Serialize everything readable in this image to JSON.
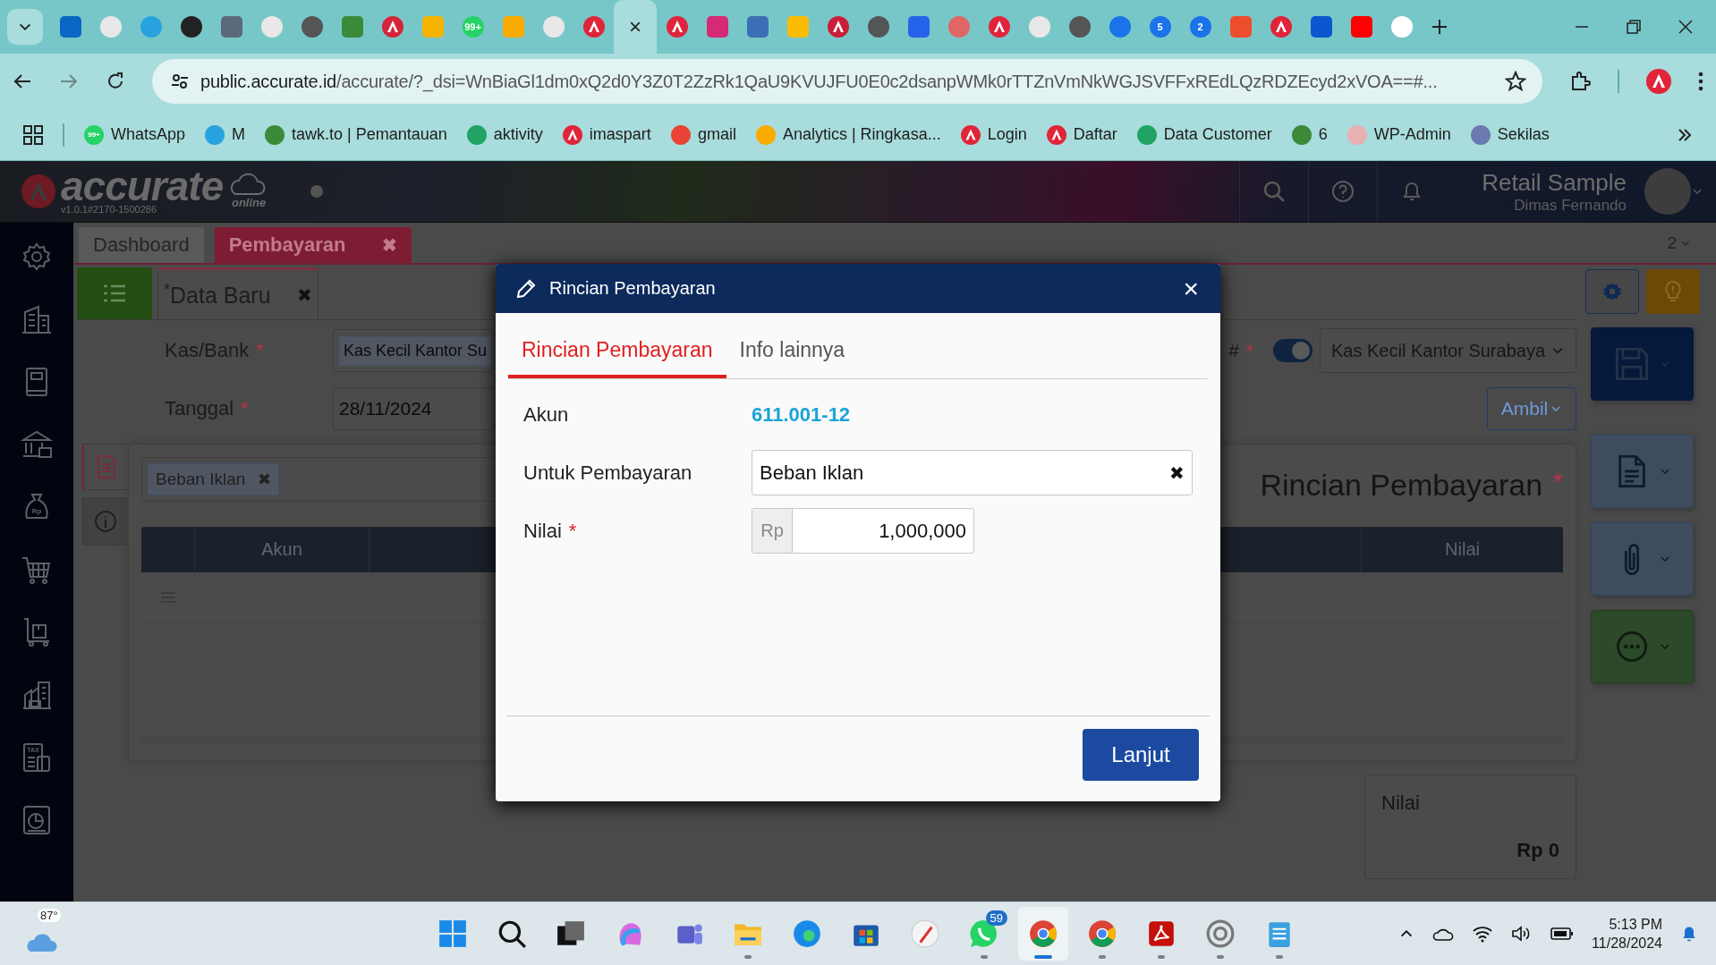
{
  "browser": {
    "tabs": [
      {
        "selected": false
      },
      {
        "selected": false
      },
      {
        "selected": false
      },
      {
        "selected": false
      },
      {
        "selected": false
      },
      {
        "selected": false
      },
      {
        "selected": false
      },
      {
        "selected": false
      },
      {
        "selected": false
      },
      {
        "selected": false
      },
      {
        "selected": false,
        "badge": "99+"
      },
      {
        "selected": false
      },
      {
        "selected": false
      },
      {
        "selected": false
      },
      {
        "selected": true,
        "close": "×"
      },
      {
        "selected": false
      },
      {
        "selected": false
      },
      {
        "selected": false
      },
      {
        "selected": false
      },
      {
        "selected": false
      },
      {
        "selected": false
      },
      {
        "selected": false
      },
      {
        "selected": false
      },
      {
        "selected": false
      },
      {
        "selected": false
      },
      {
        "selected": false
      },
      {
        "selected": false
      },
      {
        "selected": false,
        "badge": "5"
      },
      {
        "selected": false,
        "badge": "2"
      },
      {
        "selected": false
      },
      {
        "selected": false
      },
      {
        "selected": false
      },
      {
        "selected": false
      },
      {
        "selected": false
      }
    ],
    "address": {
      "host": "public.accurate.id",
      "path": "/accurate/?_dsi=WnBiaGl1dm0xQ2d0Y3Z0T2ZzRk1QaU9KVUJFU0E0c2dsanpWMk0rTTZnVmNkWGJSVFFxREdLQzRDZEcyd2xVOA==#..."
    },
    "bookmarks": [
      {
        "label": "WhatsApp",
        "badge": "99+"
      },
      {
        "label": "M"
      },
      {
        "label": "tawk.to | Pemantauan"
      },
      {
        "label": "aktivity"
      },
      {
        "label": "imaspart"
      },
      {
        "label": "gmail"
      },
      {
        "label": "Analytics | Ringkasa..."
      },
      {
        "label": "Login"
      },
      {
        "label": "Daftar"
      },
      {
        "label": "Data Customer"
      },
      {
        "label": "6"
      },
      {
        "label": "WP-Admin"
      },
      {
        "label": "Sekilas"
      }
    ]
  },
  "app": {
    "logo": "accurate",
    "logo_sub": "online",
    "version": "v1.0.1#2170-1500286",
    "company": "Retail Sample",
    "user": "Dimas Fernando"
  },
  "sidebar": {
    "bag_label": "Rp",
    "tax_label": "TAX"
  },
  "page_tabs": [
    {
      "label": "Dashboard",
      "selected": false
    },
    {
      "label": "Pembayaran",
      "selected": true,
      "close": "✖"
    }
  ],
  "tab_count": "2",
  "form": {
    "tab": {
      "label": "Data Baru",
      "modified_mark": "*",
      "close": "✖"
    },
    "fields": [
      {
        "label": "Kas/Bank",
        "mark": "*",
        "value": "Kas Kecil Kantor Su"
      },
      {
        "label": "Tanggal",
        "mark": "*",
        "value": "28/11/2024"
      }
    ],
    "number_label": "#",
    "number_mark": "*",
    "auto_number": {
      "on": true
    },
    "bank_select": "Kas Kecil Kantor Surabaya",
    "fetch_button": "Ambil"
  },
  "panel": {
    "tags": [
      {
        "label": "Beban Iklan",
        "close": "✖"
      }
    ],
    "title": "Rincian Pembayaran",
    "title_mark": "*",
    "columns": [
      "Akun",
      "Nilai"
    ]
  },
  "summary": {
    "label": "Nilai",
    "value": "Rp 0"
  },
  "modal": {
    "title": "Rincian Pembayaran",
    "close": "×",
    "tabs": [
      {
        "label": "Rincian Pembayaran",
        "selected": true
      },
      {
        "label": "Info lainnya",
        "selected": false
      }
    ],
    "rows": [
      {
        "kind": "link",
        "label": "Akun",
        "value": "611.001-12"
      },
      {
        "kind": "select",
        "label": "Untuk Pembayaran",
        "value": "Beban Iklan",
        "clear": "✖"
      },
      {
        "kind": "amount",
        "label": "Nilai",
        "mark": "*",
        "prefix": "Rp",
        "value": "1,000,000"
      }
    ],
    "button": "Lanjut"
  },
  "taskbar": {
    "weather": "87°",
    "apps": [
      {
        "selected": false,
        "running": false
      },
      {
        "selected": false,
        "running": false
      },
      {
        "selected": false,
        "running": false
      },
      {
        "selected": false,
        "running": false
      },
      {
        "selected": false,
        "running": false
      },
      {
        "selected": false,
        "running": true
      },
      {
        "selected": false,
        "running": false
      },
      {
        "selected": false,
        "running": false
      },
      {
        "selected": false,
        "running": false
      },
      {
        "selected": false,
        "running": true,
        "badge": "59"
      },
      {
        "selected": true,
        "running": true
      },
      {
        "selected": false,
        "running": true
      },
      {
        "selected": false,
        "running": true
      },
      {
        "selected": false,
        "running": true
      },
      {
        "selected": false,
        "running": true
      }
    ],
    "time": "5:13 PM",
    "date": "11/28/2024"
  }
}
